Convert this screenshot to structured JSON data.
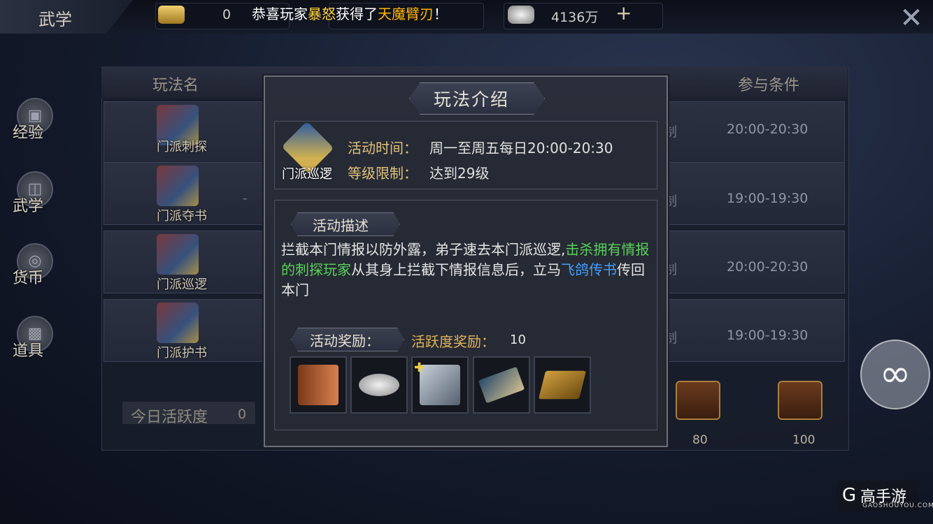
{
  "top_bar": {
    "title": "武学",
    "gold_value": "0",
    "silver_value": "4136万",
    "plus": "+",
    "notice_prefix": "恭喜玩家",
    "notice_player": "暴怒",
    "notice_mid": "获得了",
    "notice_item": "天魔臂刃",
    "notice_suffix": "！",
    "close": "✕"
  },
  "side_menu": [
    {
      "label": "经验",
      "icon": "book-icon"
    },
    {
      "label": "武学",
      "icon": "door-icon"
    },
    {
      "label": "货币",
      "icon": "coin-icon"
    },
    {
      "label": "道具",
      "icon": "chest-icon"
    }
  ],
  "bg_table": {
    "header_name": "玩法名",
    "header_condition": "参与条件",
    "rows": [
      {
        "name": "门派刺探",
        "time": "20:00-20:30"
      },
      {
        "name": "门派夺书",
        "time": "19:00-19:30"
      },
      {
        "name": "门派巡逻",
        "time": "20:00-20:30"
      },
      {
        "name": "门派护书",
        "time": "19:00-19:30"
      }
    ],
    "cut_char": "制",
    "dash": "-",
    "activity_label": "今日活跃度",
    "activity_value": "0",
    "chest_values": [
      "80",
      "100"
    ]
  },
  "dialog": {
    "title": "玩法介绍",
    "icon_label": "门派巡逻",
    "time_key": "活动时间：",
    "time_val": "周一至周五每日20:00-20:30",
    "level_key": "等级限制：",
    "level_val": "达到29级",
    "desc_title": "活动描述",
    "desc_1": "拦截本门情报以防外露，弟子速去本门派巡逻,",
    "desc_2": "击杀拥有情报的刺探玩家",
    "desc_3": "从其身上拦截下情报信息后，立马",
    "desc_4": "飞鸽传书",
    "desc_5": "传回本门",
    "reward_title": "活动奖励：",
    "active_label": "活跃度奖励：",
    "active_value": "10",
    "rewards": [
      "book-reward-icon",
      "silver-ingot-icon",
      "scroll-fragment-icon",
      "manual-scroll-icon",
      "gold-box-icon"
    ],
    "colors": {
      "highlight_green": "#59d05a",
      "highlight_blue": "#44a0ff",
      "key_gold": "#e0c27a"
    }
  },
  "watermark": {
    "logo": "G",
    "text": "高手游",
    "sub": "GAOSHOUYOU.COM"
  }
}
